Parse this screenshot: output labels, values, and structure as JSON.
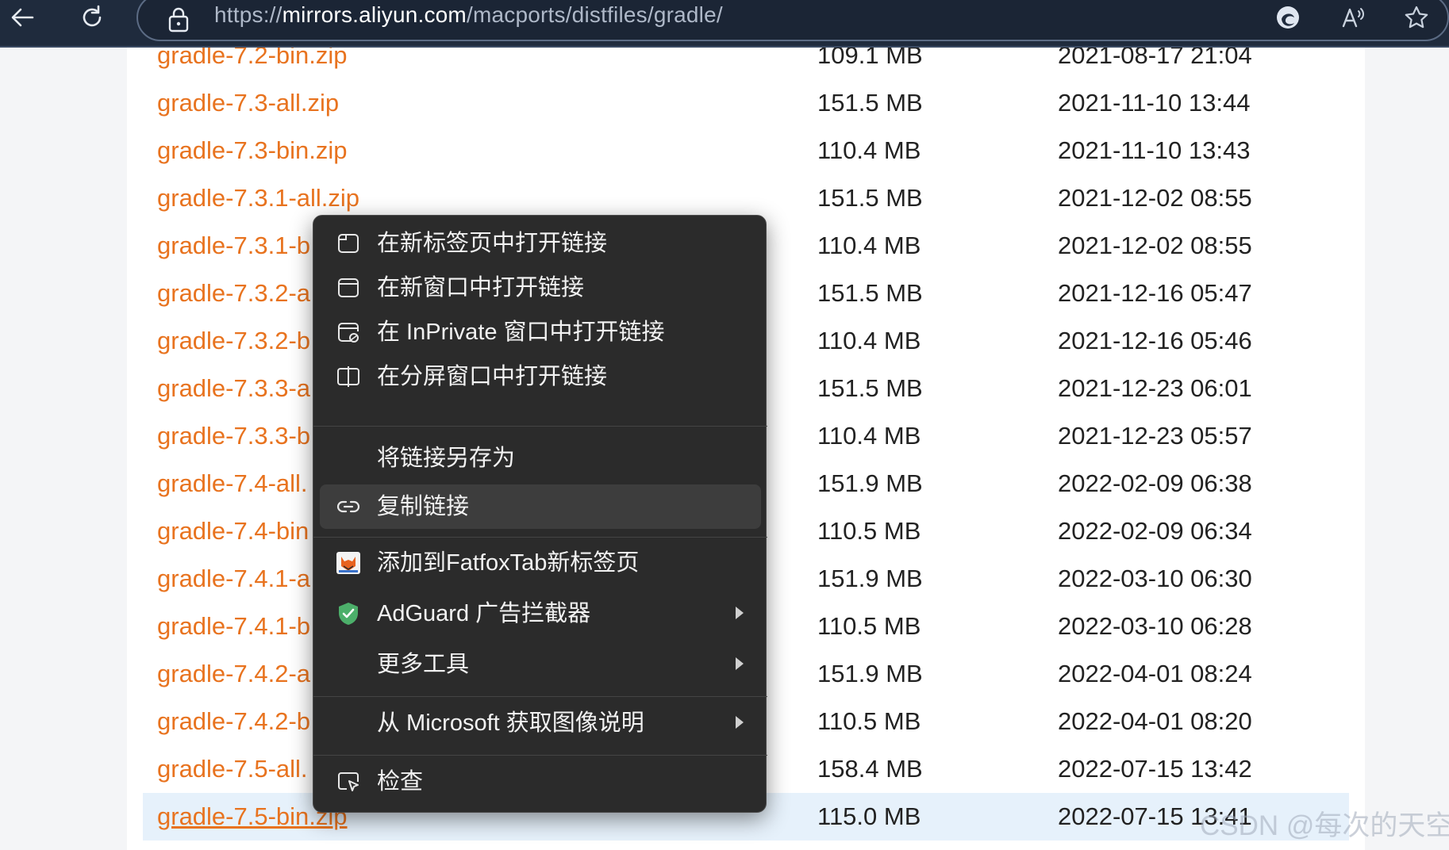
{
  "browser": {
    "url_prefix": "https://",
    "url_host": "mirrors.aliyun.com",
    "url_path": "/macports/distfiles/gradle/",
    "back_icon": "back-arrow-icon",
    "refresh_icon": "refresh-icon",
    "lock_icon": "lock-icon"
  },
  "files": [
    {
      "name": "gradle-7.2-bin.zip",
      "size": "109.1 MB",
      "date": "2021-08-17 21:04"
    },
    {
      "name": "gradle-7.3-all.zip",
      "size": "151.5 MB",
      "date": "2021-11-10 13:44"
    },
    {
      "name": "gradle-7.3-bin.zip",
      "size": "110.4 MB",
      "date": "2021-11-10 13:43"
    },
    {
      "name": "gradle-7.3.1-all.zip",
      "size": "151.5 MB",
      "date": "2021-12-02 08:55"
    },
    {
      "name": "gradle-7.3.1-b",
      "size": "110.4 MB",
      "date": "2021-12-02 08:55"
    },
    {
      "name": "gradle-7.3.2-a",
      "size": "151.5 MB",
      "date": "2021-12-16 05:47"
    },
    {
      "name": "gradle-7.3.2-b",
      "size": "110.4 MB",
      "date": "2021-12-16 05:46"
    },
    {
      "name": "gradle-7.3.3-a",
      "size": "151.5 MB",
      "date": "2021-12-23 06:01"
    },
    {
      "name": "gradle-7.3.3-b",
      "size": "110.4 MB",
      "date": "2021-12-23 05:57"
    },
    {
      "name": "gradle-7.4-all.",
      "size": "151.9 MB",
      "date": "2022-02-09 06:38"
    },
    {
      "name": "gradle-7.4-bin",
      "size": "110.5 MB",
      "date": "2022-02-09 06:34"
    },
    {
      "name": "gradle-7.4.1-a",
      "size": "151.9 MB",
      "date": "2022-03-10 06:30"
    },
    {
      "name": "gradle-7.4.1-b",
      "size": "110.5 MB",
      "date": "2022-03-10 06:28"
    },
    {
      "name": "gradle-7.4.2-a",
      "size": "151.9 MB",
      "date": "2022-04-01 08:24"
    },
    {
      "name": "gradle-7.4.2-b",
      "size": "110.5 MB",
      "date": "2022-04-01 08:20"
    },
    {
      "name": "gradle-7.5-all.",
      "size": "158.4 MB",
      "date": "2022-07-15 13:42"
    },
    {
      "name": "gradle-7.5-bin.zip",
      "size": "115.0 MB",
      "date": "2022-07-15 13:41"
    }
  ],
  "context_menu": {
    "items": [
      {
        "label": "在新标签页中打开链接",
        "icon": "new-tab-icon"
      },
      {
        "label": "在新窗口中打开链接",
        "icon": "new-window-icon"
      },
      {
        "label": "在 InPrivate 窗口中打开链接",
        "icon": "inprivate-window-icon"
      },
      {
        "label": "在分屏窗口中打开链接",
        "icon": "split-screen-icon"
      },
      {
        "label": "将链接另存为",
        "icon": ""
      },
      {
        "label": "复制链接",
        "icon": "link-icon"
      },
      {
        "label": "添加到FatfoxTab新标签页",
        "icon": "fatfoxtab-icon"
      },
      {
        "label": "AdGuard 广告拦截器",
        "icon": "adguard-shield-icon"
      },
      {
        "label": "更多工具",
        "icon": ""
      },
      {
        "label": "从 Microsoft 获取图像说明",
        "icon": ""
      },
      {
        "label": "检查",
        "icon": "inspect-icon"
      }
    ]
  },
  "watermark": "CSDN @每次的天空",
  "colors": {
    "link": "#e8731f",
    "toolbar": "#1f2b3d",
    "menu_bg": "#2b2b2b",
    "row_highlight": "#e6f1fb",
    "adguard_green": "#4caf6a"
  }
}
